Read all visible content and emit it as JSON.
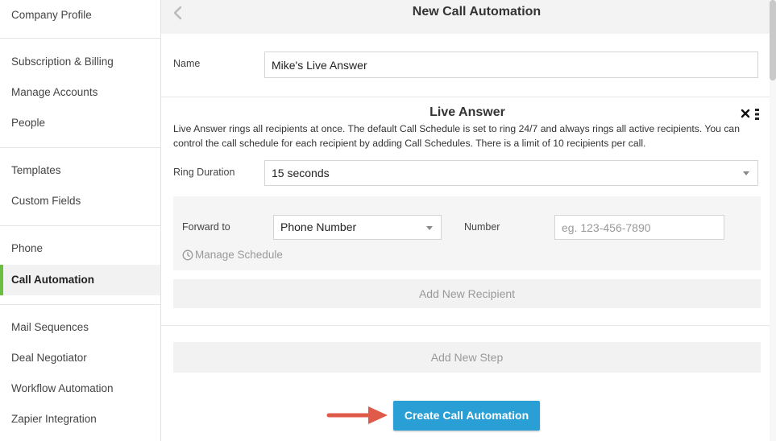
{
  "sidebar": {
    "items": [
      {
        "label": "Company Profile"
      },
      {
        "label": "Subscription & Billing"
      },
      {
        "label": "Manage Accounts"
      },
      {
        "label": "People"
      },
      {
        "label": "Templates"
      },
      {
        "label": "Custom Fields"
      },
      {
        "label": "Phone"
      },
      {
        "label": "Call Automation",
        "active": true
      },
      {
        "label": "Mail Sequences"
      },
      {
        "label": "Deal Negotiator"
      },
      {
        "label": "Workflow Automation"
      },
      {
        "label": "Zapier Integration"
      }
    ]
  },
  "header": {
    "title": "New Call Automation",
    "back_icon": "chevron-left-icon"
  },
  "form": {
    "name_label": "Name",
    "name_value": "Mike's Live Answer"
  },
  "step": {
    "title": "Live Answer",
    "close_icon": "close-icon",
    "menu_icon": "kebab-menu-icon",
    "description": "Live Answer rings all recipients at once. The default Call Schedule is set to ring 24/7 and always rings all active recipients. You can control the call schedule for each recipient by adding Call Schedules. There is a limit of 10 recipients per call.",
    "ring_duration_label": "Ring Duration",
    "ring_duration_value": "15 seconds",
    "recipient": {
      "forward_label": "Forward to",
      "forward_value": "Phone Number",
      "number_label": "Number",
      "number_placeholder": "eg. 123-456-7890",
      "manage_schedule": "Manage Schedule",
      "clock_icon": "clock-icon"
    },
    "add_recipient": "Add New Recipient"
  },
  "add_step": "Add New Step",
  "create_button": "Create Call Automation",
  "colors": {
    "accent": "#2a9fd6",
    "active_marker": "#6abf40",
    "arrow": "#e05a4a"
  }
}
